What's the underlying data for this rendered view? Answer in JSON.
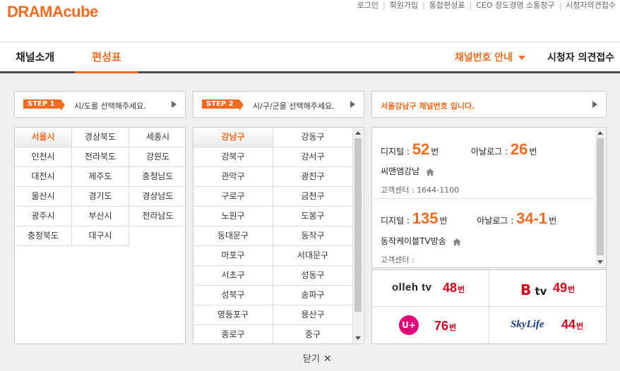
{
  "header": {
    "logo_part1": "DRAMA",
    "logo_part2": "cube",
    "util_links": [
      "로그인",
      "회원가입",
      "통합편성표",
      "CEO 정도경영 소통창구",
      "시청자의견접수"
    ]
  },
  "nav": {
    "tab_intro": "채널소개",
    "tab_schedule": "편성표",
    "channel_guide": "채널번호 안내",
    "viewer_opinion": "시청자 의견접수"
  },
  "step1": {
    "badge": "STEP 1",
    "text": "시/도를 선택해주세요."
  },
  "step2": {
    "badge": "STEP 2",
    "text": "시/구/군을 선택해주세요."
  },
  "result_title": "서울강남구 채널번호 입니다.",
  "regions": [
    "서울시",
    "경상북도",
    "세종시",
    "인천시",
    "전라북도",
    "강원도",
    "대전시",
    "제주도",
    "충청남도",
    "울산시",
    "경기도",
    "경상남도",
    "광주시",
    "부산시",
    "전라남도",
    "충청북도",
    "대구시"
  ],
  "districts": [
    "강남구",
    "강동구",
    "강북구",
    "강서구",
    "관악구",
    "광진구",
    "구로구",
    "금천구",
    "노원구",
    "도봉구",
    "동대문구",
    "동작구",
    "마포구",
    "서대문구",
    "서초구",
    "성동구",
    "성북구",
    "송파구",
    "영등포구",
    "용산구",
    "종로구",
    "중구"
  ],
  "channels": [
    {
      "digital_label": "디지털 :",
      "digital_num": "52",
      "analog_label": "아날로그 :",
      "analog_num": "26",
      "unit": "번",
      "provider": "씨앤앰강남",
      "center": "고객센터 : 1644-1100"
    },
    {
      "digital_label": "디지털 :",
      "digital_num": "135",
      "analog_label": "아날로그 :",
      "analog_num": "34-1",
      "unit": "번",
      "provider": "동작케이블TV방송",
      "center": "고객센터 :"
    }
  ],
  "operators": [
    {
      "logo": "olleh tv",
      "num": "48",
      "unit": "번"
    },
    {
      "logo": "B tv",
      "num": "49",
      "unit": "번"
    },
    {
      "logo": "U+",
      "num": "76",
      "unit": "번"
    },
    {
      "logo": "SkyLife",
      "num": "44",
      "unit": "번"
    }
  ],
  "close_label": "닫기",
  "colors": {
    "accent": "#f26b21",
    "operator_red": "#d6001c"
  }
}
